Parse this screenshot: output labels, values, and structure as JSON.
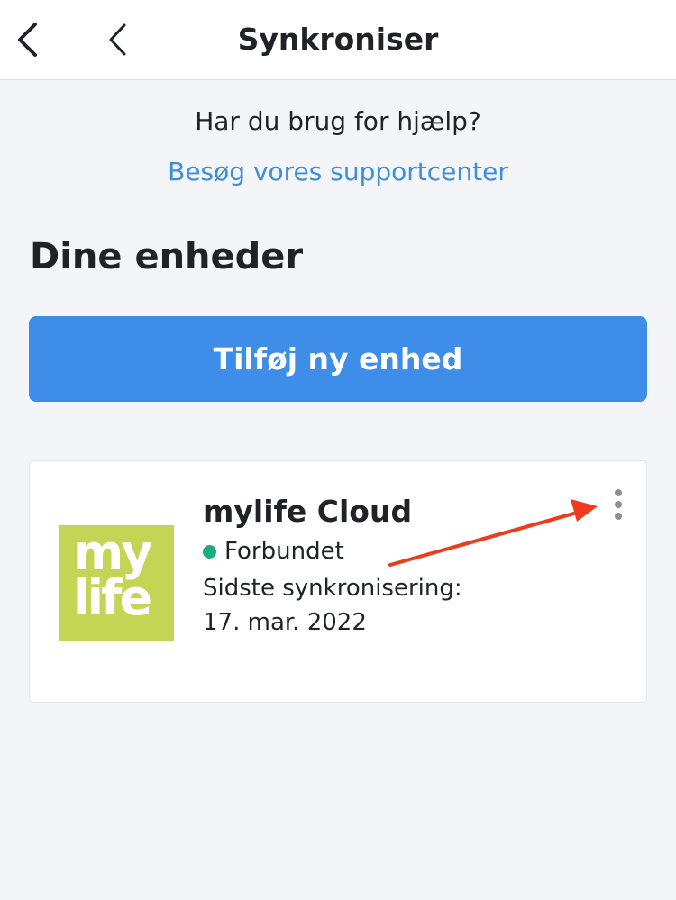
{
  "header": {
    "title": "Synkroniser",
    "back_icon": "chevron-left-icon"
  },
  "help": {
    "question": "Har du brug for hjælp?",
    "link": "Besøg vores supportcenter"
  },
  "devices_section": {
    "title": "Dine enheder",
    "add_button": "Tilføj ny enhed"
  },
  "device": {
    "logo_text": "my life",
    "name": "mylife Cloud",
    "status": "Forbundet",
    "last_sync_label": "Sidste synkronisering:",
    "last_sync_date": "17. mar. 2022",
    "menu_icon": "more-vertical-icon"
  },
  "colors": {
    "accent": "#3e8ee9",
    "link": "#3d8edb",
    "status_connected": "#1faa7a",
    "logo_bg": "#c4d454",
    "annotation": "#f03a1e"
  }
}
